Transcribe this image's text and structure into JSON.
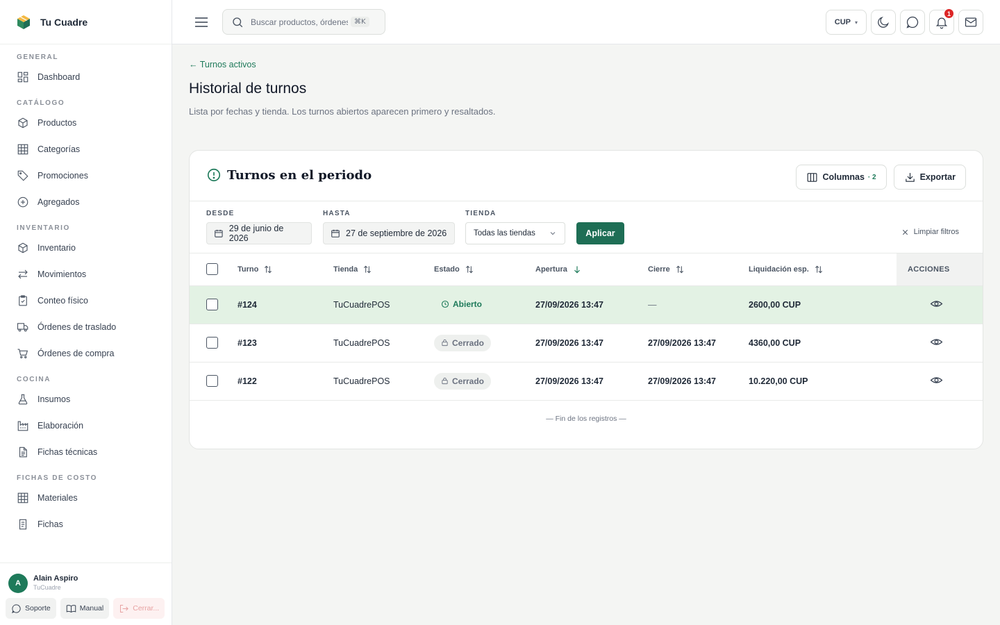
{
  "brand": {
    "name": "Tu Cuadre"
  },
  "sidebar": {
    "sections": [
      {
        "title": "GENERAL",
        "items": [
          {
            "label": "Dashboard",
            "icon": "dashboard-icon"
          }
        ]
      },
      {
        "title": "CATÁLOGO",
        "items": [
          {
            "label": "Productos",
            "icon": "box-icon"
          },
          {
            "label": "Categorías",
            "icon": "grid-icon"
          },
          {
            "label": "Promociones",
            "icon": "tag-icon"
          },
          {
            "label": "Agregados",
            "icon": "plus-circle-icon"
          }
        ]
      },
      {
        "title": "INVENTARIO",
        "items": [
          {
            "label": "Inventario",
            "icon": "box-icon"
          },
          {
            "label": "Movimientos",
            "icon": "arrows-icon"
          },
          {
            "label": "Conteo físico",
            "icon": "clipboard-icon"
          },
          {
            "label": "Órdenes de traslado",
            "icon": "truck-icon"
          },
          {
            "label": "Órdenes de compra",
            "icon": "cart-icon"
          }
        ]
      },
      {
        "title": "COCINA",
        "items": [
          {
            "label": "Insumos",
            "icon": "flask-icon"
          },
          {
            "label": "Elaboración",
            "icon": "factory-icon"
          },
          {
            "label": "Fichas técnicas",
            "icon": "document-icon"
          }
        ]
      },
      {
        "title": "FICHAS DE COSTO",
        "items": [
          {
            "label": "Materiales",
            "icon": "grid-icon"
          },
          {
            "label": "Fichas",
            "icon": "document-icon"
          }
        ]
      }
    ],
    "user": {
      "initial": "A",
      "name": "Alain Aspiro",
      "org": "TuCuadre"
    },
    "footer": {
      "support": "Soporte",
      "manual": "Manual",
      "logout": "Cerrar..."
    }
  },
  "topbar": {
    "search_placeholder": "Buscar productos, órdenes...",
    "shortcut": "⌘K",
    "currency": "CUP",
    "notifications_count": "1"
  },
  "page": {
    "back": "← Turnos activos",
    "title": "Historial de turnos",
    "subtitle": "Lista por fechas y tienda. Los turnos abiertos aparecen primero y resaltados."
  },
  "card": {
    "title": "Turnos en el periodo",
    "columns_btn": "Columnas",
    "columns_count": "· 2",
    "export_btn": "Exportar"
  },
  "filters": {
    "from_label": "DESDE",
    "from_value": "29 de junio de 2026",
    "to_label": "HASTA",
    "to_value": "27 de septiembre de 2026",
    "store_label": "TIENDA",
    "store_value": "Todas las tiendas",
    "apply": "Aplicar",
    "clear": "Limpiar filtros"
  },
  "table": {
    "headers": {
      "turn": "Turno",
      "store": "Tienda",
      "status": "Estado",
      "opening": "Apertura",
      "closing": "Cierre",
      "settlement": "Liquidación esp.",
      "actions": "ACCIONES"
    },
    "rows": [
      {
        "turn": "#124",
        "store": "TuCuadrePOS",
        "status": "Abierto",
        "opening": "27/09/2026 13:47",
        "closing": "—",
        "settlement": "2600,00 CUP"
      },
      {
        "turn": "#123",
        "store": "TuCuadrePOS",
        "status": "Cerrado",
        "opening": "27/09/2026 13:47",
        "closing": "27/09/2026 13:47",
        "settlement": "4360,00 CUP"
      },
      {
        "turn": "#122",
        "store": "TuCuadrePOS",
        "status": "Cerrado",
        "opening": "27/09/2026 13:47",
        "closing": "27/09/2026 13:47",
        "settlement": "10.220,00 CUP"
      }
    ],
    "end_message": "— Fin de los registros —"
  },
  "colors": {
    "accent": "#1e7a5a",
    "open_row": "#e3f2e4",
    "badge": "#dc2626"
  }
}
